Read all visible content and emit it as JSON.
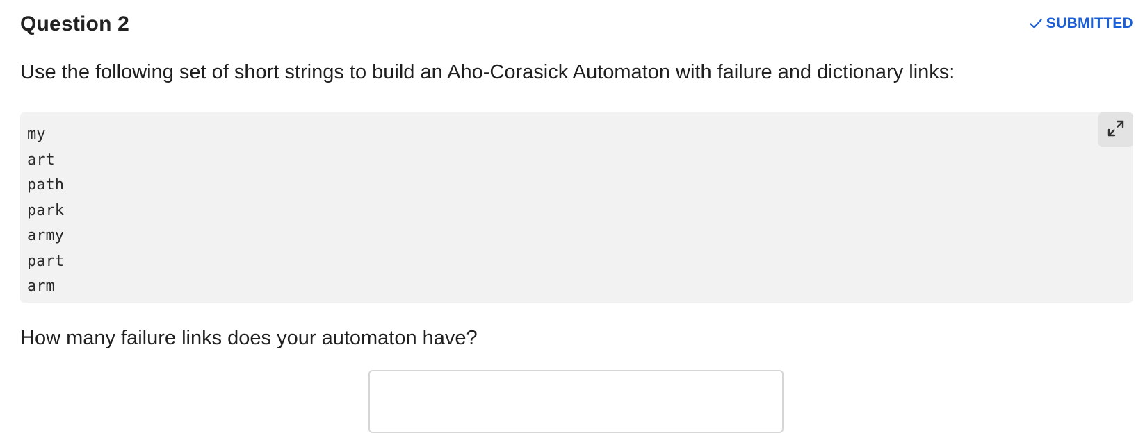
{
  "header": {
    "title": "Question 2",
    "status_icon": "check-icon",
    "status_label": "SUBMITTED",
    "status_color": "#1a5fd6"
  },
  "prompt": "Use the following set of short strings to build an Aho-Corasick Automaton with failure and dictionary links:",
  "code_block": {
    "lines": [
      "my",
      "art",
      "path",
      "park",
      "army",
      "part",
      "arm"
    ],
    "expand_icon": "expand-icon",
    "background": "#f2f2f2"
  },
  "question": "How many failure links does your automaton have?",
  "answer": {
    "value": "",
    "placeholder": ""
  }
}
